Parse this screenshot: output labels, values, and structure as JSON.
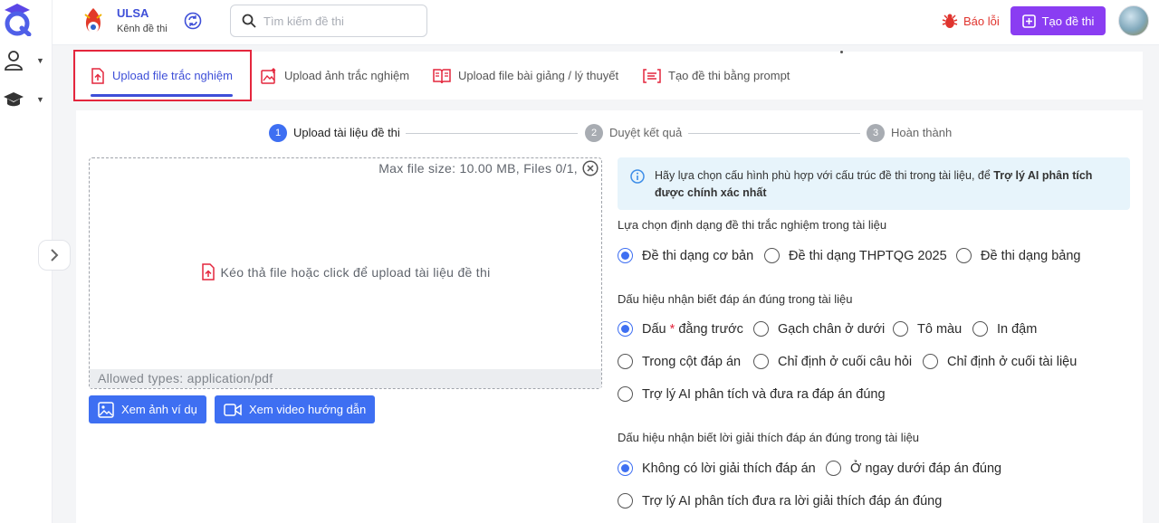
{
  "brand_colors": {
    "primary": "#3e4fd8",
    "button_blue": "#3e6ff2",
    "create_purple": "#8a3df2",
    "error_red": "#e0342e",
    "highlight": "#e4263d"
  },
  "header": {
    "channel_name": "ULSA",
    "channel_sub": "Kênh đề thi",
    "search_placeholder": "Tìm kiếm đề thi",
    "report_label": "Báo lỗi",
    "create_label": "Tạo đề thi"
  },
  "tabs": [
    {
      "label": "Upload file trắc nghiệm",
      "icon": "file-upload-icon",
      "active": true
    },
    {
      "label": "Upload ảnh trắc nghiệm",
      "icon": "image-upload-icon"
    },
    {
      "label": "Upload file bài giảng / lý thuyết",
      "icon": "book-icon"
    },
    {
      "label": "Tạo đề thi bằng prompt",
      "icon": "prompt-icon"
    }
  ],
  "steps": [
    {
      "num": "1",
      "label": "Upload tài liệu đề thi",
      "active": true
    },
    {
      "num": "2",
      "label": "Duyệt kết quả"
    },
    {
      "num": "3",
      "label": "Hoàn thành"
    }
  ],
  "dropzone": {
    "info": "Max file size: 10.00 MB, Files 0/1,",
    "prompt": "Kéo thả file hoặc click để upload tài liệu đề thi",
    "allowed": "Allowed types: application/pdf"
  },
  "buttons": {
    "example_image": "Xem ảnh ví dụ",
    "video_guide": "Xem video hướng dẫn"
  },
  "info": {
    "text": "Hãy lựa chọn cấu hình phù hợp với cấu trúc đề thi trong tài liệu, để ",
    "bold": "Trợ lý AI phân tích được chính xác nhất"
  },
  "format_section": {
    "title": "Lựa chọn định dạng đề thi trắc nghiệm trong tài liệu",
    "options": [
      "Đề thi dạng cơ bản",
      "Đề thi dạng THPTQG 2025",
      "Đề thi dạng bảng"
    ],
    "selected": "Đề thi dạng cơ bản"
  },
  "answer_section": {
    "title": "Dấu hiệu nhận biết đáp án đúng trong tài liệu",
    "opt_mark_pre": "Dấu",
    "opt_mark_star": "*",
    "opt_mark_post": "đằng trước",
    "options": [
      "Gạch chân ở dưới",
      "Tô màu",
      "In đậm",
      "Trong cột đáp án",
      "Chỉ định ở cuối câu hỏi",
      "Chỉ định ở cuối tài liệu",
      "Trợ lý AI phân tích và đưa ra đáp án đúng"
    ],
    "selected": "Dấu * đằng trước"
  },
  "explain_section": {
    "title": "Dấu hiệu nhận biết lời giải thích đáp án đúng trong tài liệu",
    "options": [
      "Không có lời giải thích đáp án",
      "Ở ngay dưới đáp án đúng",
      "Trợ lý AI phân tích đưa ra lời giải thích đáp án đúng"
    ],
    "selected": "Không có lời giải thích đáp án"
  }
}
